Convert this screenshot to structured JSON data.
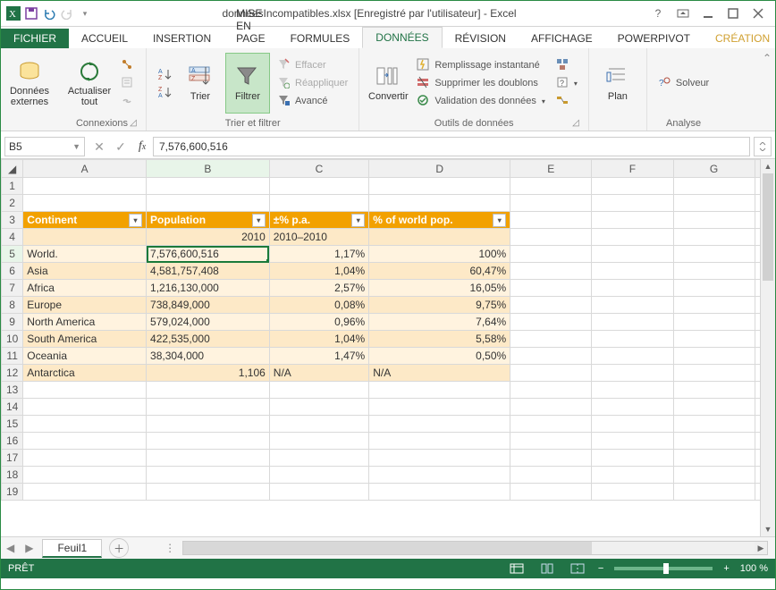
{
  "window": {
    "title": "donnéesIncompatibles.xlsx [Enregistré par l'utilisateur] - Excel"
  },
  "tabs": {
    "file": "FICHIER",
    "home": "ACCUEIL",
    "insert": "INSERTION",
    "layout": "MISE EN PAGE",
    "formulas": "FORMULES",
    "data": "DONNÉES",
    "review": "RÉVISION",
    "view": "AFFICHAGE",
    "powerpivot": "POWERPIVOT",
    "creation": "CRÉATION"
  },
  "ribbon": {
    "ext": {
      "label": "Données\nexternes",
      "group": "Connexions"
    },
    "refresh": "Actualiser\ntout",
    "connections_group": "Connexions",
    "sort": "Trier",
    "filter": "Filtrer",
    "clear": "Effacer",
    "reapply": "Réappliquer",
    "advanced": "Avancé",
    "sort_group": "Trier et filtrer",
    "convert": "Convertir",
    "flash": "Remplissage instantané",
    "dedupe": "Supprimer les doublons",
    "validate": "Validation des données",
    "data_tools_group": "Outils de données",
    "plan": "Plan",
    "solver": "Solveur",
    "analysis_group": "Analyse"
  },
  "fx": {
    "namebox": "B5",
    "formula": "7,576,600,516"
  },
  "columns": [
    "A",
    "B",
    "C",
    "D",
    "E",
    "F",
    "G"
  ],
  "table": {
    "hdr": {
      "a": "Continent",
      "b": "Population",
      "c": "±% p.a.",
      "d": "% of world pop."
    },
    "sub": {
      "b": "2010",
      "c": "2010–2010"
    },
    "rows": [
      {
        "a": "World.",
        "b": "7,576,600,516",
        "c": "1,17%",
        "d": "100%"
      },
      {
        "a": "Asia",
        "b": "4,581,757,408",
        "c": "1,04%",
        "d": "60,47%"
      },
      {
        "a": "Africa",
        "b": "1,216,130,000",
        "c": "2,57%",
        "d": "16,05%"
      },
      {
        "a": "Europe",
        "b": "738,849,000",
        "c": "0,08%",
        "d": "9,75%"
      },
      {
        "a": "North America",
        "b": "579,024,000",
        "c": "0,96%",
        "d": "7,64%"
      },
      {
        "a": "South America",
        "b": "422,535,000",
        "c": "1,04%",
        "d": "5,58%"
      },
      {
        "a": "Oceania",
        "b": "38,304,000",
        "c": "1,47%",
        "d": "0,50%"
      },
      {
        "a": "Antarctica",
        "b": "1,106",
        "c": "N/A",
        "d": "N/A"
      }
    ]
  },
  "sheets": {
    "s1": "Feuil1"
  },
  "status": {
    "ready": "PRÊT",
    "zoom": "100 %"
  },
  "chart_data": {
    "type": "table",
    "title": "World population by continent",
    "columns": [
      "Continent",
      "Population 2010",
      "±% p.a. 2010–2010",
      "% of world pop."
    ],
    "rows": [
      [
        "World.",
        7576600516,
        1.17,
        100.0
      ],
      [
        "Asia",
        4581757408,
        1.04,
        60.47
      ],
      [
        "Africa",
        1216130000,
        2.57,
        16.05
      ],
      [
        "Europe",
        738849000,
        0.08,
        9.75
      ],
      [
        "North America",
        579024000,
        0.96,
        7.64
      ],
      [
        "South America",
        422535000,
        1.04,
        5.58
      ],
      [
        "Oceania",
        38304000,
        1.47,
        0.5
      ],
      [
        "Antarctica",
        1106,
        null,
        null
      ]
    ]
  }
}
